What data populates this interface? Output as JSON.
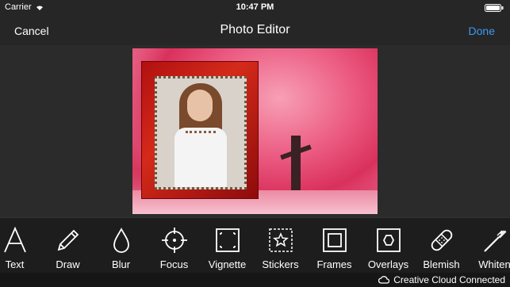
{
  "status_bar": {
    "carrier": "Carrier",
    "time": "10:47 PM"
  },
  "nav": {
    "cancel": "Cancel",
    "title": "Photo Editor",
    "done": "Done"
  },
  "tools": [
    {
      "label": "Text",
      "icon": "text-icon"
    },
    {
      "label": "Draw",
      "icon": "pencil-icon"
    },
    {
      "label": "Blur",
      "icon": "drop-icon"
    },
    {
      "label": "Focus",
      "icon": "focus-icon"
    },
    {
      "label": "Vignette",
      "icon": "vignette-icon"
    },
    {
      "label": "Stickers",
      "icon": "star-icon"
    },
    {
      "label": "Frames",
      "icon": "frame-icon"
    },
    {
      "label": "Overlays",
      "icon": "hexagon-icon"
    },
    {
      "label": "Blemish",
      "icon": "bandage-icon"
    },
    {
      "label": "Whiten",
      "icon": "toothbrush-icon"
    }
  ],
  "footer": {
    "status": "Creative Cloud Connected"
  },
  "colors": {
    "accent": "#3a9bf2",
    "background": "#1f1f1f"
  }
}
